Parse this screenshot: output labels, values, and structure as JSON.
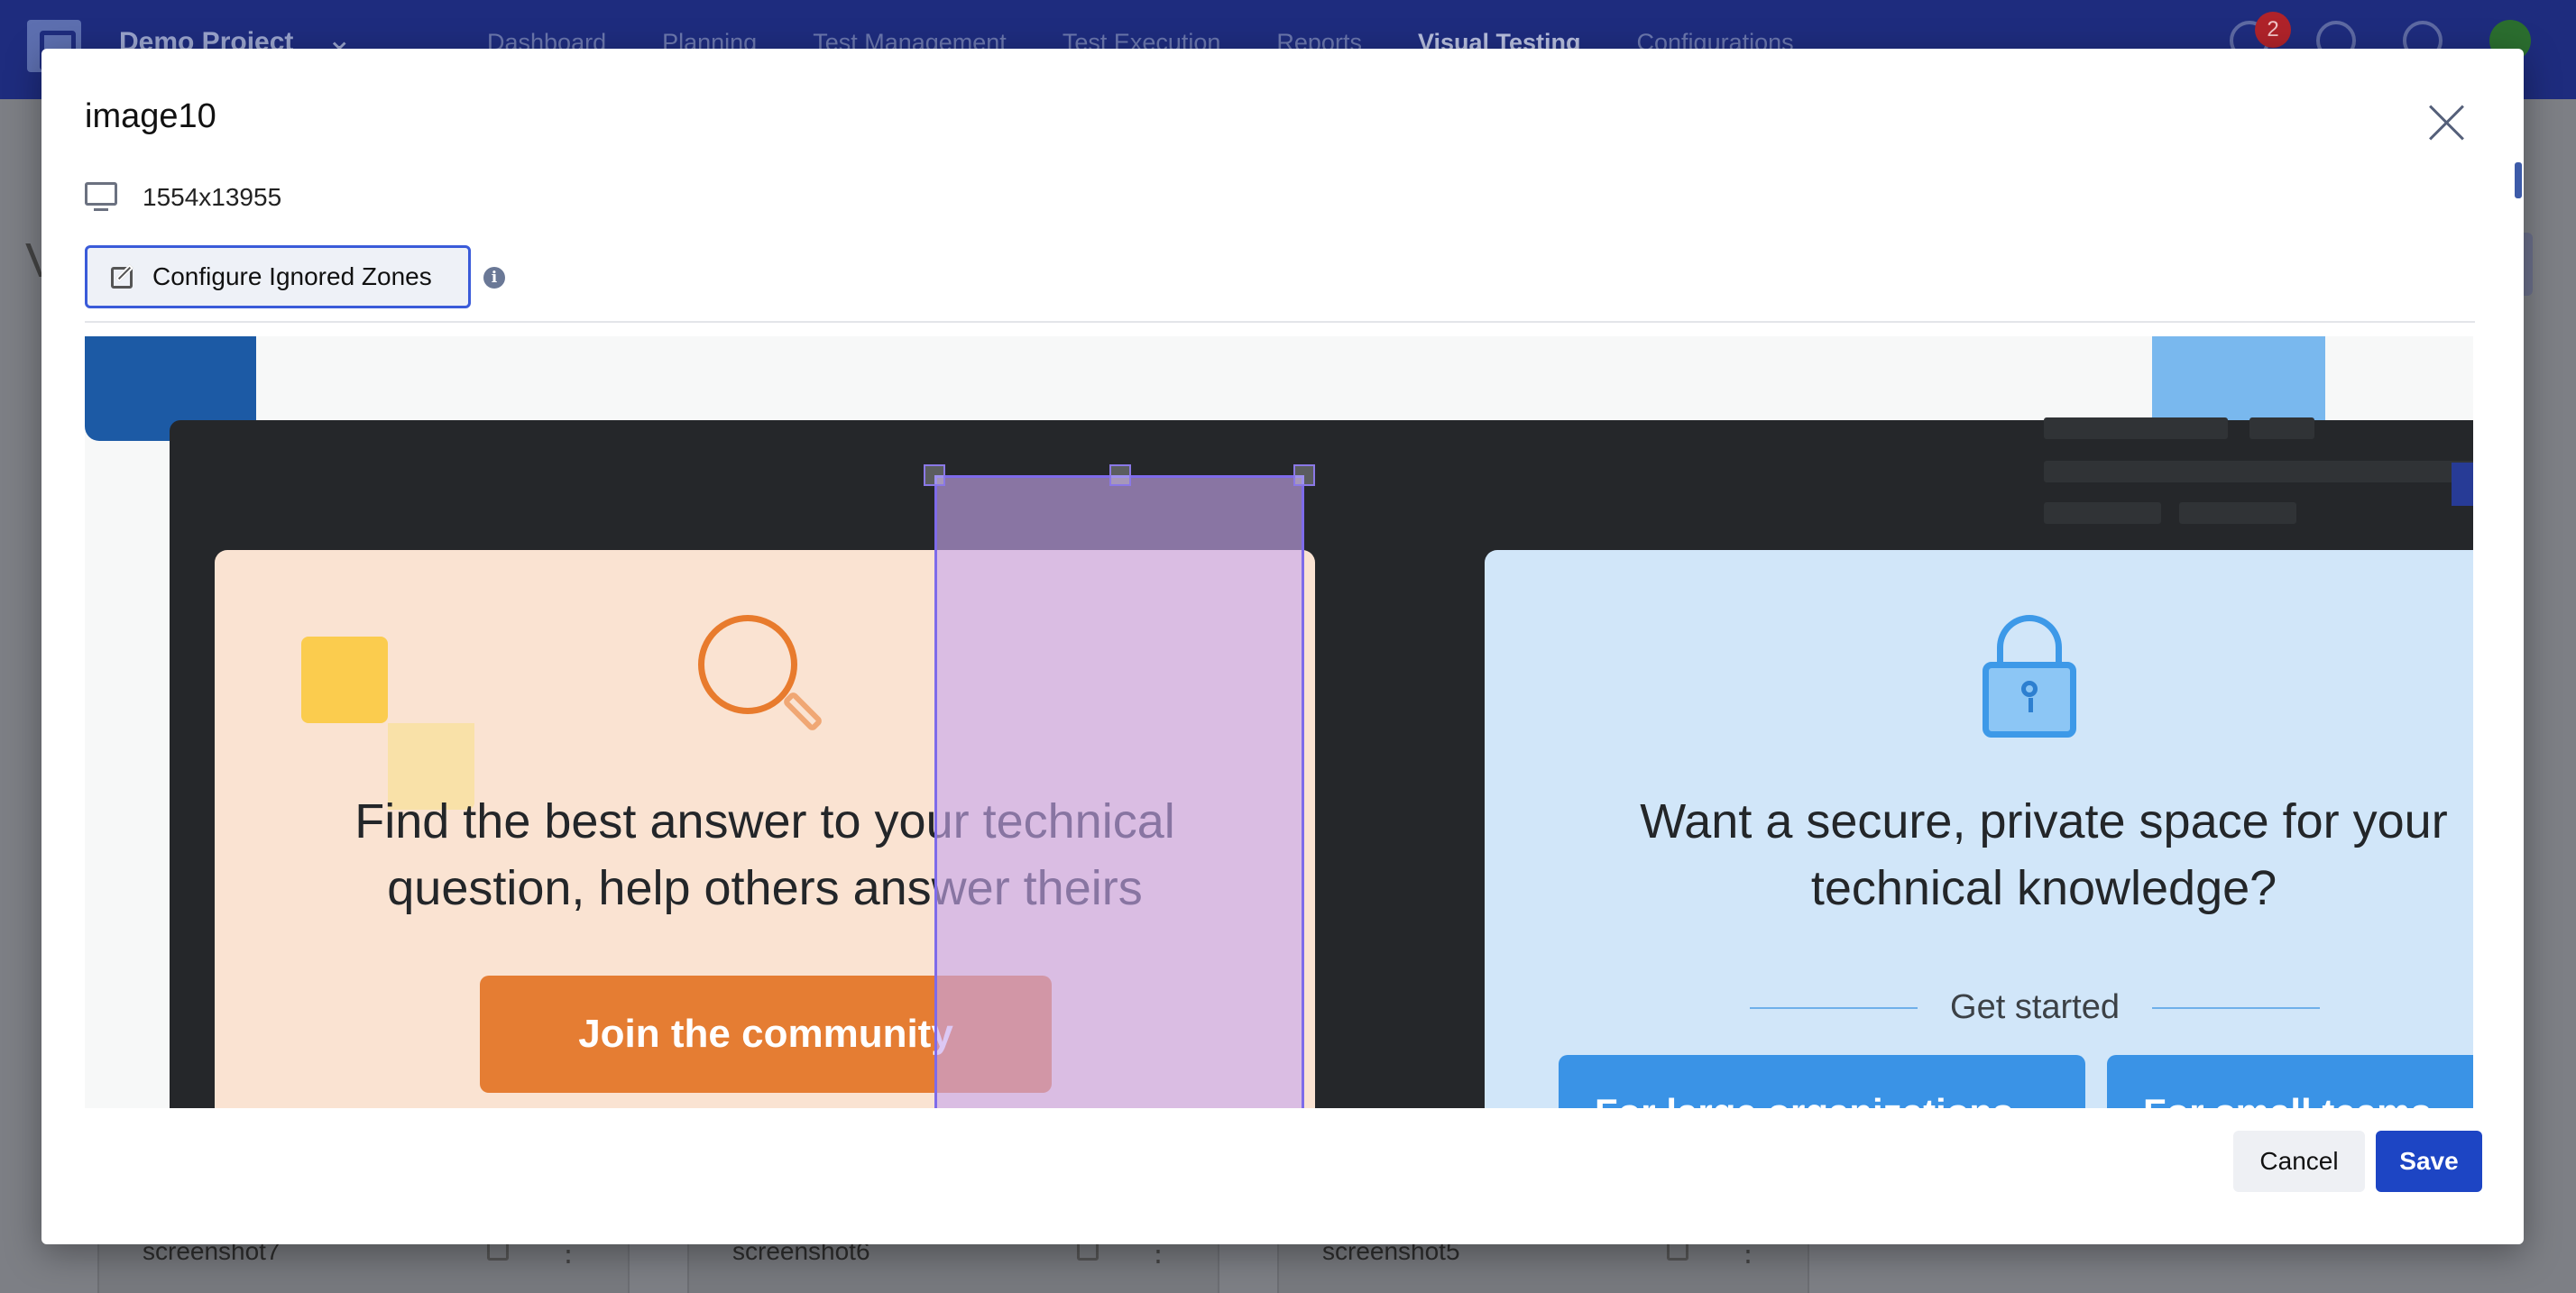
{
  "app": {
    "project_name": "Demo Project",
    "nav": [
      "Dashboard",
      "Planning",
      "Test Management",
      "Test Execution",
      "Reports",
      "Visual Testing",
      "Configurations"
    ],
    "active_nav": "Visual Testing",
    "notifications_count": "2",
    "page_letter": "V",
    "background_cards": [
      "screenshot7",
      "screenshot6",
      "screenshot5"
    ]
  },
  "modal": {
    "title": "image10",
    "resolution": "1554x13955",
    "configure_button": "Configure Ignored Zones",
    "info_glyph": "i",
    "cancel_label": "Cancel",
    "save_label": "Save"
  },
  "preview": {
    "left_card_heading_line1": "Find the best answer to your technical",
    "left_card_heading_line2": "question, help others answer theirs",
    "left_card_button": "Join the community",
    "right_card_heading_line1": "Want a secure, private space for your",
    "right_card_heading_line2": "technical knowledge?",
    "get_started": "Get started",
    "btn_large_orgs": "For large organizations",
    "btn_small_teams": "For small teams"
  },
  "icons": {
    "monitor": "monitor-icon",
    "edit": "pencil-icon",
    "info": "info-icon",
    "close": "close-icon",
    "search": "magnifier-icon",
    "lock": "lock-icon"
  },
  "colors": {
    "topbar": "#1e2c7e",
    "primary": "#1d45c4",
    "ignore_zone_fill": "#c6a6ee",
    "ignore_zone_border": "#7e6bea",
    "orange_card": "#fae3d2",
    "orange_button": "#e57d33",
    "blue_card": "#d1e6f9",
    "blue_button": "#3a93e6"
  }
}
